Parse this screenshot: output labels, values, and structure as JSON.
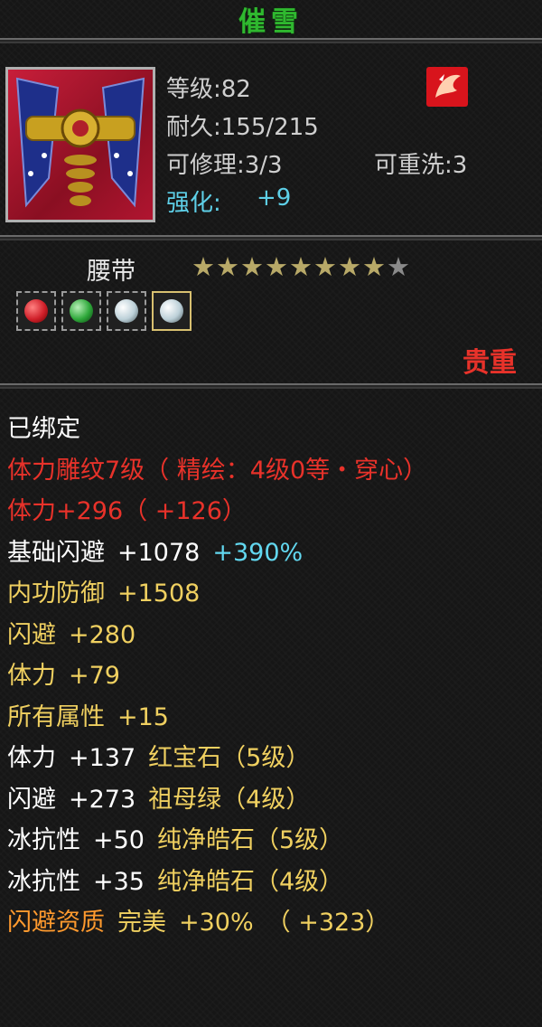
{
  "item": {
    "name": "催雪",
    "level": "等级:82",
    "durability": "耐久:155/215",
    "repairs": "可修理:3/3",
    "rewash": "可重洗:3",
    "enhance_label": "强化:",
    "enhance_value": "+9",
    "type": "腰带",
    "stars": {
      "filled": 8,
      "total": 9
    },
    "rarity": "贵重"
  },
  "gems": [
    {
      "name": "ruby-gem-icon",
      "color": "#d0202a"
    },
    {
      "name": "emerald-gem-icon",
      "color": "#2ea83a"
    },
    {
      "name": "diamond-gem-icon",
      "color": "#d8e8ee"
    },
    {
      "name": "diamond-gem-icon",
      "color": "#d8e8ee"
    }
  ],
  "attributes": {
    "bound": "已绑定",
    "engrave": "体力雕纹7级（ 精绘：4级0等・穿心）",
    "stamina_total": "体力+296（ +126）",
    "base_dodge_label": "基础闪避",
    "base_dodge_value": "+1078",
    "base_dodge_pct": "+390%",
    "inner_defense_label": "内功防御",
    "inner_defense_value": "+1508",
    "dodge_label": "闪避",
    "dodge_value": "+280",
    "stamina_label": "体力",
    "stamina_value": "+79",
    "all_attr_label": "所有属性",
    "all_attr_value": "+15",
    "gem1_stat": "体力",
    "gem1_value": "+137",
    "gem1_name": "红宝石（5级）",
    "gem2_stat": "闪避",
    "gem2_value": "+273",
    "gem2_name": "祖母绿（4级）",
    "gem3_stat": "冰抗性",
    "gem3_value": "+50",
    "gem3_name": "纯净皓石（5级）",
    "gem4_stat": "冰抗性",
    "gem4_value": "+35",
    "gem4_name": "纯净皓石（4级）",
    "aptitude_label": "闪避资质",
    "aptitude_grade": "完美",
    "aptitude_pct": "+30%",
    "aptitude_bonus": "（ +323）"
  }
}
